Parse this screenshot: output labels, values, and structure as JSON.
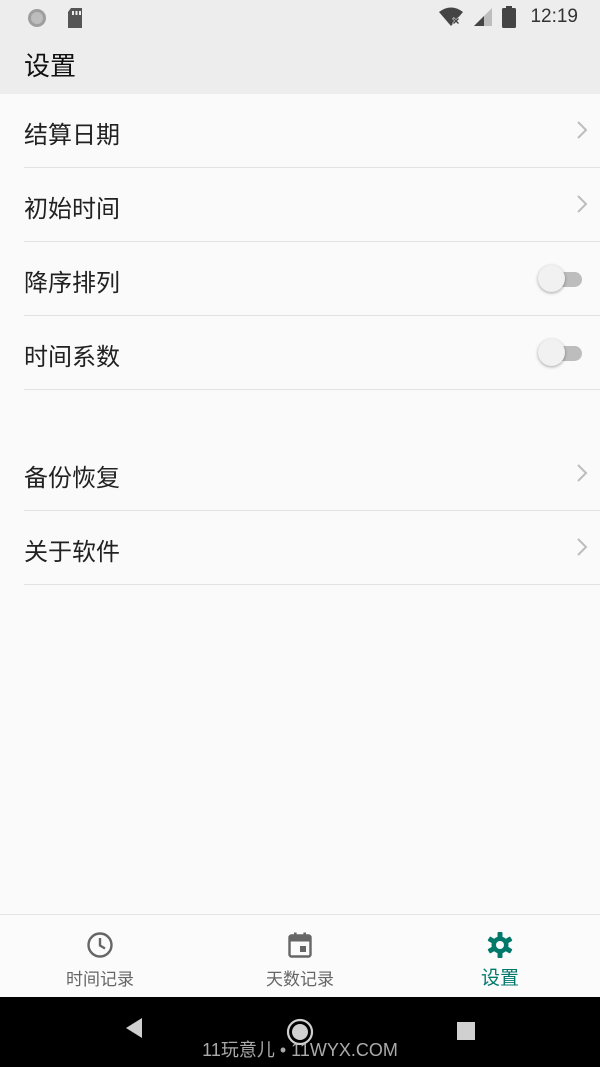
{
  "status_bar": {
    "time": "12:19",
    "icons": [
      "notification-dot-icon",
      "sd-card-icon",
      "wifi-off-icon",
      "cell-signal-icon",
      "battery-icon"
    ]
  },
  "app_bar": {
    "title": "设置"
  },
  "settings": {
    "items": [
      {
        "label": "结算日期",
        "control": "chevron"
      },
      {
        "label": "初始时间",
        "control": "chevron"
      },
      {
        "label": "降序排列",
        "control": "toggle",
        "on": false
      },
      {
        "label": "时间系数",
        "control": "toggle",
        "on": false
      }
    ],
    "items2": [
      {
        "label": "备份恢复",
        "control": "chevron"
      },
      {
        "label": "关于软件",
        "control": "chevron"
      }
    ]
  },
  "bottom_nav": {
    "items": [
      {
        "label": "时间记录",
        "icon": "clock-icon",
        "active": false
      },
      {
        "label": "天数记录",
        "icon": "calendar-icon",
        "active": false
      },
      {
        "label": "设置",
        "icon": "gear-icon",
        "active": true
      }
    ]
  },
  "colors": {
    "accent": "#00796b",
    "app_bar_bg": "#ededed",
    "page_bg": "#fafafa"
  },
  "watermark": "11玩意儿 • 11WYX.COM"
}
